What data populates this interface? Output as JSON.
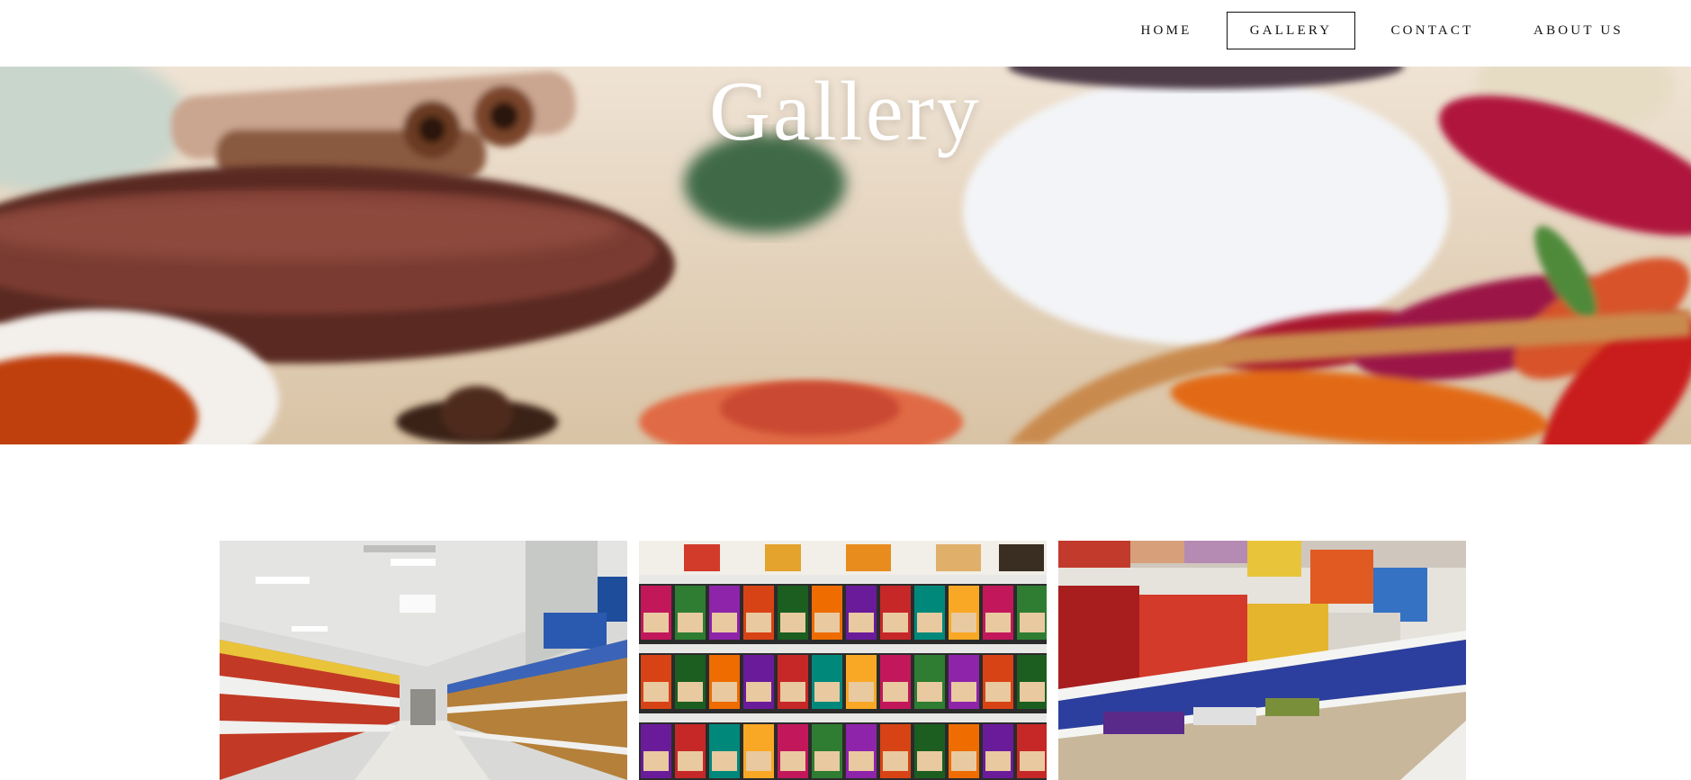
{
  "nav": {
    "items": [
      {
        "label": "HOME",
        "active": false
      },
      {
        "label": "GALLERY",
        "active": true
      },
      {
        "label": "CONTACT",
        "active": false
      },
      {
        "label": "ABOUT US",
        "active": false
      }
    ]
  },
  "hero": {
    "title": "Gallery",
    "image": "spices-background"
  },
  "gallery": {
    "images": [
      {
        "name": "grocery-aisle-photo"
      },
      {
        "name": "spice-box-shelf-photo"
      },
      {
        "name": "snack-shelf-photo"
      }
    ]
  }
}
